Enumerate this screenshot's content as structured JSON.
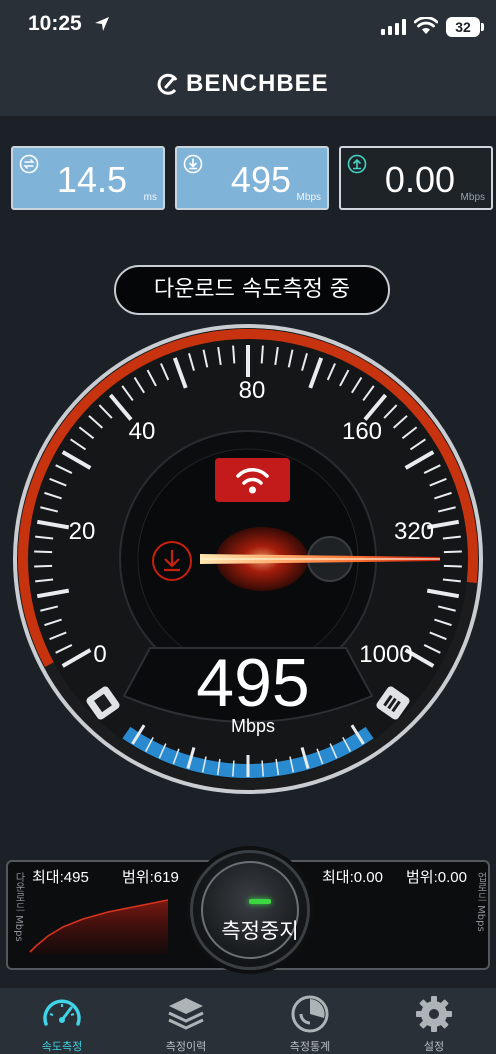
{
  "status_bar": {
    "time": "10:25",
    "battery": "32"
  },
  "header": {
    "app_name": "BENCHBEE"
  },
  "stats": [
    {
      "name": "ping",
      "value": "14.5",
      "unit": "ms",
      "icon": "ping-arrows-icon"
    },
    {
      "name": "download",
      "value": "495",
      "unit": "Mbps",
      "icon": "download-circle-icon"
    },
    {
      "name": "upload",
      "value": "0.00",
      "unit": "Mbps",
      "icon": "upload-circle-icon"
    }
  ],
  "status_pill": "다운로드 속도측정 중",
  "gauge": {
    "current_value": "495",
    "unit": "Mbps",
    "scale_labels": [
      "0",
      "20",
      "40",
      "80",
      "160",
      "320",
      "1000"
    ],
    "accent_red": "#c8330f",
    "accent_blue": "#2a8ad0"
  },
  "bottom_panel": {
    "left_max": "최대:495",
    "left_range": "범위:619",
    "right_max": "최대:0.00",
    "right_range": "범위:0.00",
    "left_axis_label": "다운로드 Mbps",
    "right_axis_label": "업로드 Mbps",
    "stop_button": "측정중지"
  },
  "tabs": [
    {
      "label": "속도측정",
      "icon": "speedometer-icon",
      "active": true
    },
    {
      "label": "측정이력",
      "icon": "layers-icon",
      "active": false
    },
    {
      "label": "측정통계",
      "icon": "statistics-icon",
      "active": false
    },
    {
      "label": "설정",
      "icon": "gear-icon",
      "active": false
    }
  ]
}
